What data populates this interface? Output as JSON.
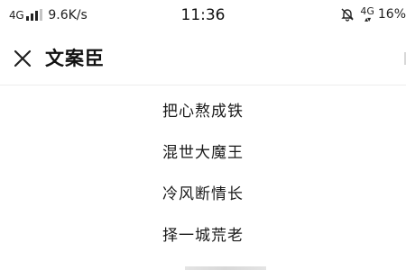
{
  "status_bar": {
    "network": "4G",
    "speed": "9.6K/s",
    "time": "11:36",
    "right_network": "4G",
    "battery": "16%",
    "icons": [
      "signal-icon",
      "mute-bell-icon",
      "data-arrows-icon"
    ]
  },
  "nav": {
    "close_icon": "close-icon",
    "title": "文案臣"
  },
  "list": {
    "items": [
      {
        "label": "把心熬成铁"
      },
      {
        "label": "混世大魔王"
      },
      {
        "label": "冷风断情长"
      },
      {
        "label": "择一城荒老"
      }
    ]
  }
}
